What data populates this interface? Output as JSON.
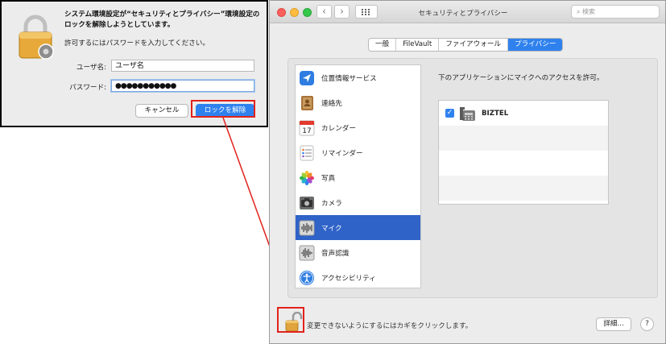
{
  "auth_dialog": {
    "title": "システム環境設定が“セキュリティとプライバシー”環境設定のロックを解除しようとしています。",
    "message": "許可するにはパスワードを入力してください。",
    "username_label": "ユーザ名:",
    "username_value": "ユーザ名",
    "password_label": "パスワード:",
    "password_value": "●●●●●●●●●●●",
    "cancel_label": "キャンセル",
    "unlock_label": "ロックを解除"
  },
  "window": {
    "title": "セキュリティとプライバシー",
    "search_placeholder": "検索"
  },
  "tabs": [
    {
      "label": "一般"
    },
    {
      "label": "FileVault"
    },
    {
      "label": "ファイアウォール"
    },
    {
      "label": "プライバシー"
    }
  ],
  "services": [
    {
      "label": "位置情報サービス",
      "icon": "location-arrow-icon"
    },
    {
      "label": "連絡先",
      "icon": "contacts-book-icon"
    },
    {
      "label": "カレンダー",
      "icon": "calendar-icon"
    },
    {
      "label": "リマインダー",
      "icon": "reminders-list-icon"
    },
    {
      "label": "写真",
      "icon": "photos-flower-icon"
    },
    {
      "label": "カメラ",
      "icon": "camera-icon"
    },
    {
      "label": "マイク",
      "icon": "microphone-waveform-icon"
    },
    {
      "label": "音声認識",
      "icon": "speech-waveform-icon"
    },
    {
      "label": "アクセシビリティ",
      "icon": "accessibility-person-icon"
    }
  ],
  "calendar_icon_day": "17",
  "selected_service_index": 6,
  "right_pane": {
    "heading": "下のアプリケーションにマイクへのアクセスを許可。",
    "apps": [
      {
        "name": "BIZTEL",
        "checked": true,
        "icon": "phone-handset-icon"
      }
    ]
  },
  "footer": {
    "lock_text": "変更できないようにするにはカギをクリックします。",
    "details_label": "詳細...",
    "help_label": "?"
  },
  "colors": {
    "accent": "#2f82ee",
    "selection": "#2f63c8",
    "annotation": "#e2221b"
  }
}
